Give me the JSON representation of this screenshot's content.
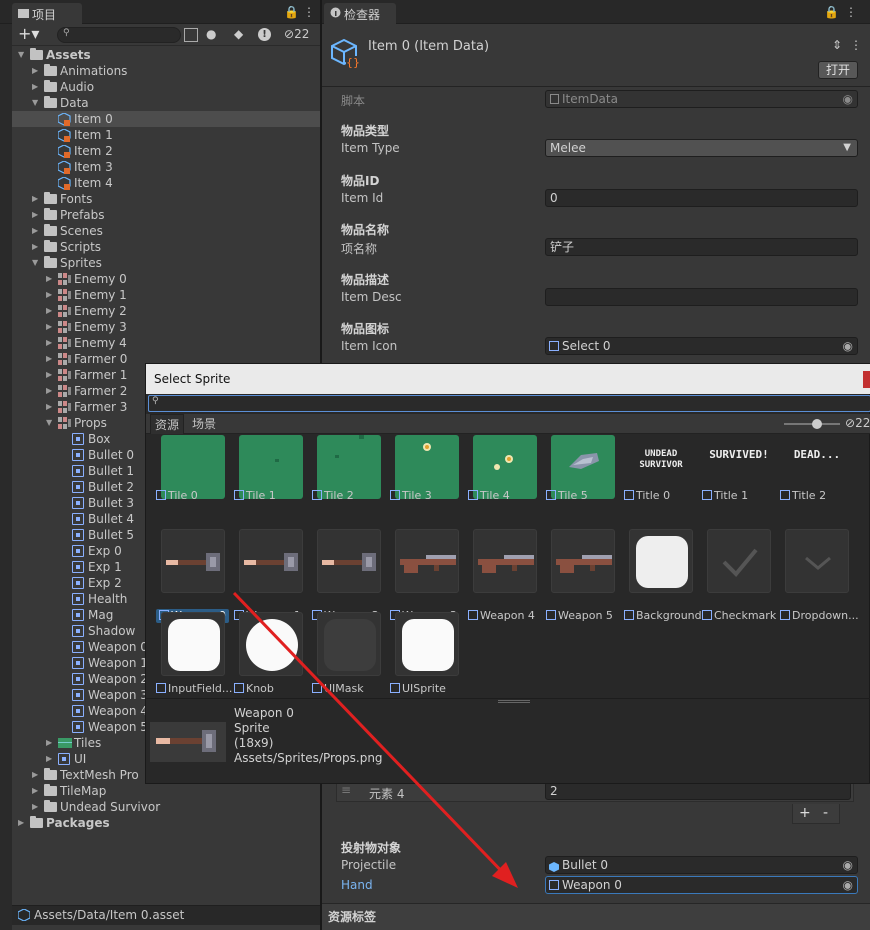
{
  "project": {
    "tab": "项目",
    "search_count": "22",
    "status_path": "Assets/Data/Item 0.asset",
    "tree": [
      {
        "label": "Assets",
        "indent": 0,
        "arrow": "open",
        "icon": "folder",
        "bold": true
      },
      {
        "label": "Animations",
        "indent": 1,
        "arrow": "closed",
        "icon": "folder"
      },
      {
        "label": "Audio",
        "indent": 1,
        "arrow": "closed",
        "icon": "folder"
      },
      {
        "label": "Data",
        "indent": 1,
        "arrow": "open",
        "icon": "folder"
      },
      {
        "label": "Item 0",
        "indent": 2,
        "icon": "cube",
        "selected": true
      },
      {
        "label": "Item 1",
        "indent": 2,
        "icon": "cube"
      },
      {
        "label": "Item 2",
        "indent": 2,
        "icon": "cube"
      },
      {
        "label": "Item 3",
        "indent": 2,
        "icon": "cube"
      },
      {
        "label": "Item 4",
        "indent": 2,
        "icon": "cube"
      },
      {
        "label": "Fonts",
        "indent": 1,
        "arrow": "closed",
        "icon": "folder"
      },
      {
        "label": "Prefabs",
        "indent": 1,
        "arrow": "closed",
        "icon": "folder"
      },
      {
        "label": "Scenes",
        "indent": 1,
        "arrow": "closed",
        "icon": "folder"
      },
      {
        "label": "Scripts",
        "indent": 1,
        "arrow": "closed",
        "icon": "folder"
      },
      {
        "label": "Sprites",
        "indent": 1,
        "arrow": "open",
        "icon": "folder"
      },
      {
        "label": "Enemy 0",
        "indent": 2,
        "arrow": "closed",
        "icon": "sheet"
      },
      {
        "label": "Enemy 1",
        "indent": 2,
        "arrow": "closed",
        "icon": "sheet"
      },
      {
        "label": "Enemy 2",
        "indent": 2,
        "arrow": "closed",
        "icon": "sheet"
      },
      {
        "label": "Enemy 3",
        "indent": 2,
        "arrow": "closed",
        "icon": "sheet"
      },
      {
        "label": "Enemy 4",
        "indent": 2,
        "arrow": "closed",
        "icon": "sheet"
      },
      {
        "label": "Farmer 0",
        "indent": 2,
        "arrow": "closed",
        "icon": "sheet"
      },
      {
        "label": "Farmer 1",
        "indent": 2,
        "arrow": "closed",
        "icon": "sheet"
      },
      {
        "label": "Farmer 2",
        "indent": 2,
        "arrow": "closed",
        "icon": "sheet"
      },
      {
        "label": "Farmer 3",
        "indent": 2,
        "arrow": "closed",
        "icon": "sheet"
      },
      {
        "label": "Props",
        "indent": 2,
        "arrow": "open",
        "icon": "sheet"
      },
      {
        "label": "Box",
        "indent": 3,
        "icon": "sprite"
      },
      {
        "label": "Bullet 0",
        "indent": 3,
        "icon": "sprite"
      },
      {
        "label": "Bullet 1",
        "indent": 3,
        "icon": "sprite"
      },
      {
        "label": "Bullet 2",
        "indent": 3,
        "icon": "sprite"
      },
      {
        "label": "Bullet 3",
        "indent": 3,
        "icon": "sprite"
      },
      {
        "label": "Bullet 4",
        "indent": 3,
        "icon": "sprite"
      },
      {
        "label": "Bullet 5",
        "indent": 3,
        "icon": "sprite"
      },
      {
        "label": "Exp 0",
        "indent": 3,
        "icon": "sprite"
      },
      {
        "label": "Exp 1",
        "indent": 3,
        "icon": "sprite"
      },
      {
        "label": "Exp 2",
        "indent": 3,
        "icon": "sprite"
      },
      {
        "label": "Health",
        "indent": 3,
        "icon": "sprite"
      },
      {
        "label": "Mag",
        "indent": 3,
        "icon": "sprite"
      },
      {
        "label": "Shadow",
        "indent": 3,
        "icon": "sprite"
      },
      {
        "label": "Weapon 0",
        "indent": 3,
        "icon": "sprite"
      },
      {
        "label": "Weapon 1",
        "indent": 3,
        "icon": "sprite"
      },
      {
        "label": "Weapon 2",
        "indent": 3,
        "icon": "sprite"
      },
      {
        "label": "Weapon 3",
        "indent": 3,
        "icon": "sprite"
      },
      {
        "label": "Weapon 4",
        "indent": 3,
        "icon": "sprite"
      },
      {
        "label": "Weapon 5",
        "indent": 3,
        "icon": "sprite"
      },
      {
        "label": "Tiles",
        "indent": 2,
        "arrow": "closed",
        "icon": "tiles"
      },
      {
        "label": "UI",
        "indent": 2,
        "arrow": "closed",
        "icon": "sprite"
      },
      {
        "label": "TextMesh Pro",
        "indent": 1,
        "arrow": "closed",
        "icon": "folder"
      },
      {
        "label": "TileMap",
        "indent": 1,
        "arrow": "closed",
        "icon": "folder"
      },
      {
        "label": "Undead Survivor",
        "indent": 1,
        "arrow": "closed",
        "icon": "folder"
      },
      {
        "label": "Packages",
        "indent": 0,
        "arrow": "closed",
        "icon": "folder",
        "bold": true
      }
    ]
  },
  "inspector": {
    "tab": "检查器",
    "title": "Item 0 (Item Data)",
    "open_button": "打开",
    "script_label": "脚本",
    "script_value": "ItemData",
    "fields": [
      {
        "header": "物品类型",
        "label": "Item Type",
        "value": "Melee",
        "dropdown": true
      },
      {
        "header": "物品ID",
        "label": "Item Id",
        "value": "0"
      },
      {
        "header": "物品名称",
        "label": "项名称",
        "value": "铲子"
      },
      {
        "header": "物品描述",
        "label": "Item Desc",
        "value": ""
      },
      {
        "header": "物品图标",
        "label": "Item Icon",
        "value": "Select 0",
        "picker": true
      }
    ],
    "element_label": "元素 4",
    "element_value": "2",
    "plus": "+",
    "minus": "-",
    "proj_header": "投射物对象",
    "proj_label": "Projectile",
    "proj_value": "Bullet 0",
    "hand_label": "Hand",
    "hand_value": "Weapon 0",
    "footer": "资源标签"
  },
  "dialog": {
    "title": "Select Sprite",
    "tab_assets": "资源",
    "tab_scene": "场景",
    "count": "22",
    "sprites": [
      {
        "name": "Tile 0",
        "kind": "tile0"
      },
      {
        "name": "Tile 1",
        "kind": "tile1"
      },
      {
        "name": "Tile 2",
        "kind": "tile2"
      },
      {
        "name": "Tile 3",
        "kind": "tile3"
      },
      {
        "name": "Tile 4",
        "kind": "tile4"
      },
      {
        "name": "Tile 5",
        "kind": "tile5"
      },
      {
        "name": "Title 0",
        "kind": "title0",
        "text": "UNDEAD SURVIVOR"
      },
      {
        "name": "Title 1",
        "kind": "title1",
        "text": "SURVIVED!"
      },
      {
        "name": "Title 2",
        "kind": "title2",
        "text": "DEAD..."
      },
      {
        "name": "Weapon 0",
        "kind": "weapon",
        "selected": true
      },
      {
        "name": "Weapon 1",
        "kind": "weapon"
      },
      {
        "name": "Weapon 2",
        "kind": "weapon"
      },
      {
        "name": "Weapon 3",
        "kind": "gun"
      },
      {
        "name": "Weapon 4",
        "kind": "gun"
      },
      {
        "name": "Weapon 5",
        "kind": "gun"
      },
      {
        "name": "Background",
        "kind": "bg"
      },
      {
        "name": "Checkmark",
        "kind": "check"
      },
      {
        "name": "Dropdown...",
        "kind": "drop"
      },
      {
        "name": "InputField...",
        "kind": "input"
      },
      {
        "name": "Knob",
        "kind": "knob"
      },
      {
        "name": "UIMask",
        "kind": "mask"
      },
      {
        "name": "UISprite",
        "kind": "uisprite"
      }
    ],
    "preview": {
      "name": "Weapon 0",
      "type": "Sprite",
      "size": "(18x9)",
      "path": "Assets/Sprites/Props.png"
    }
  },
  "colors": {
    "accent": "#e02020",
    "tile": "#2e8a5a",
    "selection": "#2c5d87"
  }
}
